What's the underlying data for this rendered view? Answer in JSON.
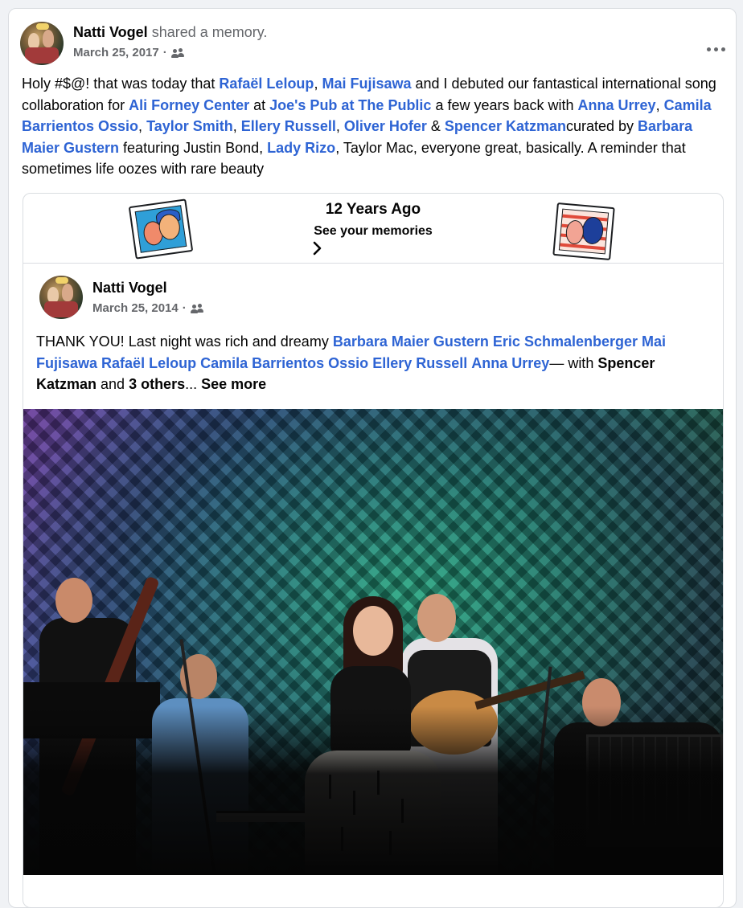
{
  "post": {
    "author": "Natti Vogel",
    "action": "shared a memory.",
    "date": "March 25, 2017",
    "separator": "·",
    "privacy_icon": "friends-icon",
    "more_icon": "more-horizontal-icon",
    "text": {
      "t1": "Holy #$@! that was today that ",
      "l1": "Rafaël Leloup",
      "t2": ", ",
      "l2": "Mai Fujisawa",
      "t3": " and I debuted our fantastical international song collaboration for ",
      "l3": "Ali Forney Center",
      "t4": " at ",
      "l4": "Joe's Pub at The Public",
      "t5": " a few years back with ",
      "l5": "Anna Urrey",
      "t6": ", ",
      "l6": "Camila Barrientos Ossio",
      "t7": ", ",
      "l7": "Taylor Smith",
      "t8": ", ",
      "l8": "Ellery Russell",
      "t9": ", ",
      "l9": "Oliver Hofer",
      "t10": " & ",
      "l10": "Spencer Katzman",
      "t11": "curated by ",
      "l11": "Barbara Maier Gustern",
      "t12": " featuring Justin Bond, ",
      "l12": "Lady Rizo",
      "t13": ", Taylor Mac, everyone great, basically. A reminder that sometimes life oozes with rare beauty"
    }
  },
  "memory": {
    "title": "12 Years Ago",
    "subtitle": "See your memories",
    "chevron_icon": "chevron-right-icon"
  },
  "original_post": {
    "author": "Natti Vogel",
    "date": "March 25, 2014",
    "separator": "·",
    "privacy_icon": "friends-icon",
    "text": {
      "t1": "THANK YOU! Last night was rich and dreamy ",
      "l1": "Barbara Maier Gustern",
      "s1": " ",
      "l2": "Eric Schmalenberger",
      "s2": " ",
      "l3": "Mai Fujisawa",
      "s3": " ",
      "l4": "Rafaël Leloup",
      "s4": " ",
      "l5": "Camila Barrientos Ossio",
      "s5": " ",
      "l6": "Ellery Russell",
      "s6": " ",
      "l7": "Anna Urrey",
      "t2": "— with ",
      "b1": "Spencer Katzman",
      "t3": " and ",
      "b2": "3 others",
      "t4": "... ",
      "see_more": "See more"
    }
  },
  "colors": {
    "link": "#2e64d4",
    "text": "#050505",
    "secondary": "#65676b",
    "border": "#dadde1"
  }
}
